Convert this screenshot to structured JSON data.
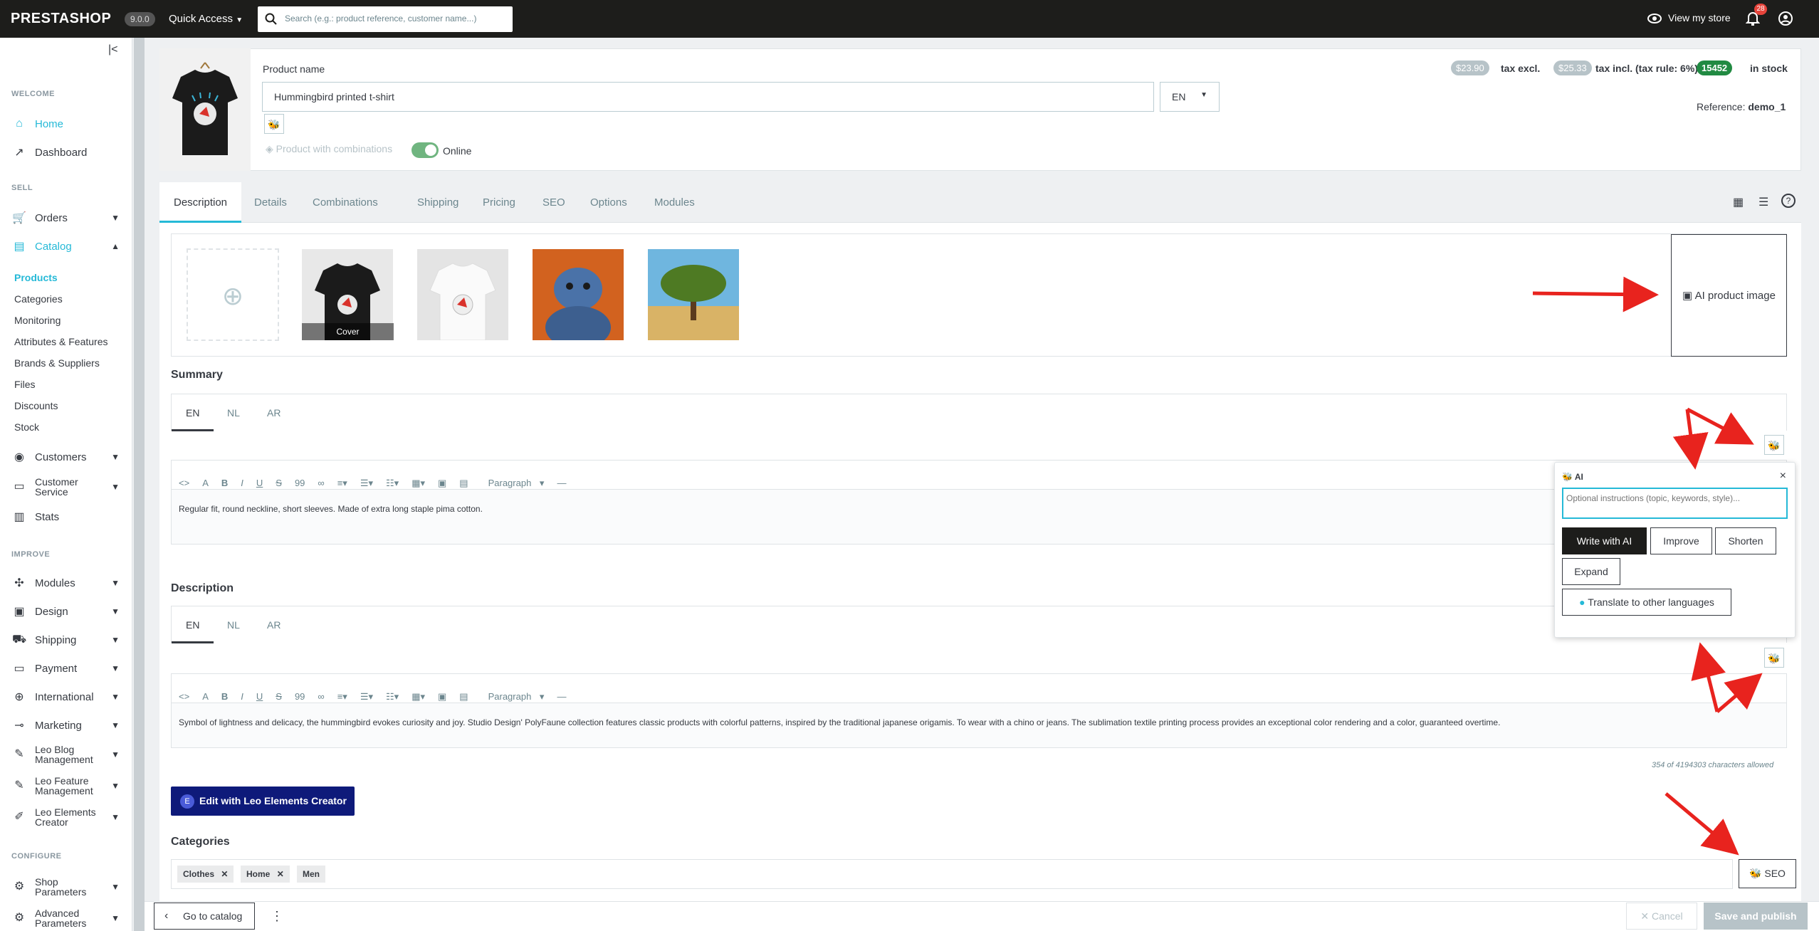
{
  "topbar": {
    "logo": "PRESTASHOP",
    "version": "9.0.0",
    "quick_access": "Quick Access",
    "search_placeholder": "Search (e.g.: product reference, customer name...)",
    "view_store": "View my store",
    "notif_count": "28"
  },
  "sidebar": {
    "sections": {
      "welcome": "WELCOME",
      "sell": "SELL",
      "improve": "IMPROVE",
      "configure": "CONFIGURE"
    },
    "items": {
      "home": "Home",
      "dashboard": "Dashboard",
      "orders": "Orders",
      "catalog": "Catalog",
      "customers": "Customers",
      "customer_service_1": "Customer",
      "customer_service_2": "Service",
      "stats": "Stats",
      "modules": "Modules",
      "design": "Design",
      "shipping": "Shipping",
      "payment": "Payment",
      "international": "International",
      "marketing": "Marketing",
      "leo_blog_1": "Leo Blog",
      "leo_blog_2": "Management",
      "leo_feature_1": "Leo Feature",
      "leo_feature_2": "Management",
      "leo_elements_1": "Leo Elements",
      "leo_elements_2": "Creator",
      "shop_params_1": "Shop",
      "shop_params_2": "Parameters",
      "advanced_params_1": "Advanced",
      "advanced_params_2": "Parameters"
    },
    "catalog_sub": [
      "Products",
      "Categories",
      "Monitoring",
      "Attributes & Features",
      "Brands & Suppliers",
      "Files",
      "Discounts",
      "Stock"
    ]
  },
  "product": {
    "name_label": "Product name",
    "name_value": "Hummingbird printed t-shirt",
    "lang": "EN",
    "combinations_label": "Product with combinations",
    "online_label": "Online",
    "price_excl": "$23.90",
    "tax_excl_label": "tax excl.",
    "price_incl": "$25.33",
    "tax_incl_label": "tax incl. (tax rule: 6%)",
    "stock": "15452",
    "stock_label": "in stock",
    "reference_label": "Reference:",
    "reference_value": "demo_1"
  },
  "tabs": [
    "Description",
    "Details",
    "Combinations",
    "Shipping",
    "Pricing",
    "SEO",
    "Options",
    "Modules"
  ],
  "images": {
    "cover_label": "Cover",
    "ai_image_button": "AI product image"
  },
  "summary": {
    "title": "Summary",
    "langs": [
      "EN",
      "NL",
      "AR"
    ],
    "paragraph_label": "Paragraph",
    "text": "Regular fit, round neckline, short sleeves. Made of extra long staple pima cotton."
  },
  "description": {
    "title": "Description",
    "langs": [
      "EN",
      "NL",
      "AR"
    ],
    "paragraph_label": "Paragraph",
    "text": "Symbol of lightness and delicacy, the hummingbird evokes curiosity and joy. Studio Design' PolyFaune collection features classic products with colorful patterns, inspired by the traditional japanese origamis. To wear with a chino or jeans. The sublimation textile printing process provides an exceptional color rendering and a color, guaranteed overtime.",
    "chars": "354 of 4194303 characters allowed"
  },
  "ai_popup": {
    "title": "AI",
    "placeholder": "Optional instructions (topic, keywords, style)...",
    "write": "Write with AI",
    "improve": "Improve",
    "shorten": "Shorten",
    "expand": "Expand",
    "translate": "Translate to other languages"
  },
  "leo_button": "Edit with Leo Elements Creator",
  "categories": {
    "title": "Categories",
    "chips": [
      "Clothes",
      "Home",
      "Men"
    ],
    "seo_button": "SEO"
  },
  "footer": {
    "go_to_catalog": "Go to catalog",
    "cancel": "Cancel",
    "save": "Save and publish"
  },
  "colors": {
    "accent": "#25b9d7",
    "dark": "#1d1d1b",
    "green": "#70b580",
    "arrow": "#e8231e"
  }
}
